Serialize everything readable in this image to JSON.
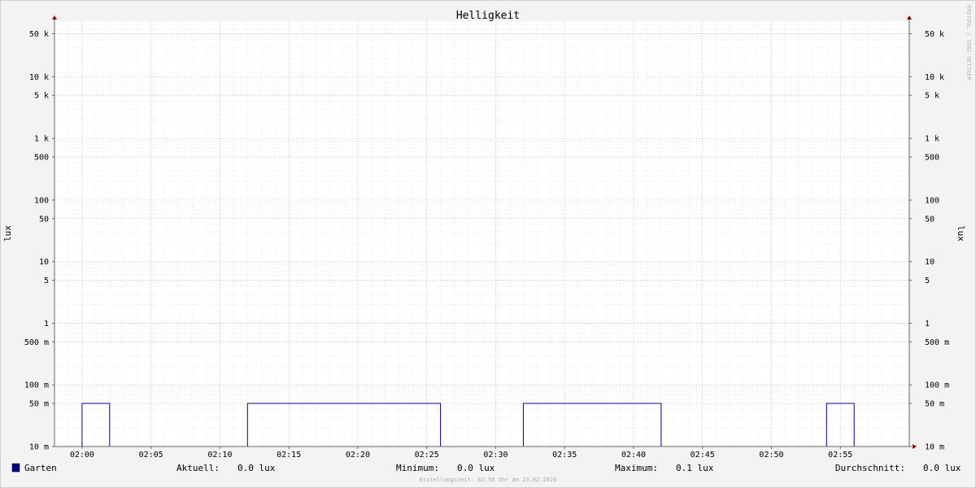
{
  "chart_data": {
    "type": "line",
    "title": "Helligkeit",
    "ylabel": "lux",
    "y_scale": "log",
    "ylim": [
      0.01,
      80000
    ],
    "xlim": [
      "01:58",
      "03:00"
    ],
    "x_ticks": [
      "02:00",
      "02:05",
      "02:10",
      "02:15",
      "02:20",
      "02:25",
      "02:30",
      "02:35",
      "02:40",
      "02:45",
      "02:50",
      "02:55"
    ],
    "y_ticks": [
      {
        "v": 50000,
        "label": "50 k"
      },
      {
        "v": 10000,
        "label": "10 k"
      },
      {
        "v": 5000,
        "label": "5 k"
      },
      {
        "v": 1000,
        "label": "1 k"
      },
      {
        "v": 500,
        "label": "500"
      },
      {
        "v": 100,
        "label": "100"
      },
      {
        "v": 50,
        "label": "50"
      },
      {
        "v": 10,
        "label": "10"
      },
      {
        "v": 5,
        "label": "5"
      },
      {
        "v": 1,
        "label": "1"
      },
      {
        "v": 0.5,
        "label": "500 m"
      },
      {
        "v": 0.1,
        "label": "100 m"
      },
      {
        "v": 0.05,
        "label": "50 m"
      },
      {
        "v": 0.01,
        "label": "10 m"
      }
    ],
    "series": [
      {
        "name": "Garten",
        "color": "#00008b",
        "points": [
          [
            "01:58",
            0.01
          ],
          [
            "02:00",
            0.01
          ],
          [
            "02:00",
            0.05
          ],
          [
            "02:02",
            0.05
          ],
          [
            "02:02",
            0.01
          ],
          [
            "02:12",
            0.01
          ],
          [
            "02:12",
            0.05
          ],
          [
            "02:26",
            0.05
          ],
          [
            "02:26",
            0.01
          ],
          [
            "02:32",
            0.01
          ],
          [
            "02:32",
            0.05
          ],
          [
            "02:42",
            0.05
          ],
          [
            "02:42",
            0.01
          ],
          [
            "02:54",
            0.01
          ],
          [
            "02:54",
            0.05
          ],
          [
            "02:56",
            0.05
          ],
          [
            "02:56",
            0.01
          ],
          [
            "02:58",
            0.01
          ]
        ]
      }
    ],
    "grid": true
  },
  "legend": {
    "series_name": "Garten",
    "series_color": "#00008b",
    "stats": [
      {
        "label": "Aktuell:",
        "value": "0.0 lux"
      },
      {
        "label": "Minimum:",
        "value": "0.0 lux"
      },
      {
        "label": "Maximum:",
        "value": "0.1 lux"
      },
      {
        "label": "Durchschnitt:",
        "value": "0.0 lux"
      }
    ]
  },
  "footer": "Erstellungszeit: 02:58 Uhr am 23.02.2026",
  "watermark": "RRDTOOL / TOBI OETIKER"
}
